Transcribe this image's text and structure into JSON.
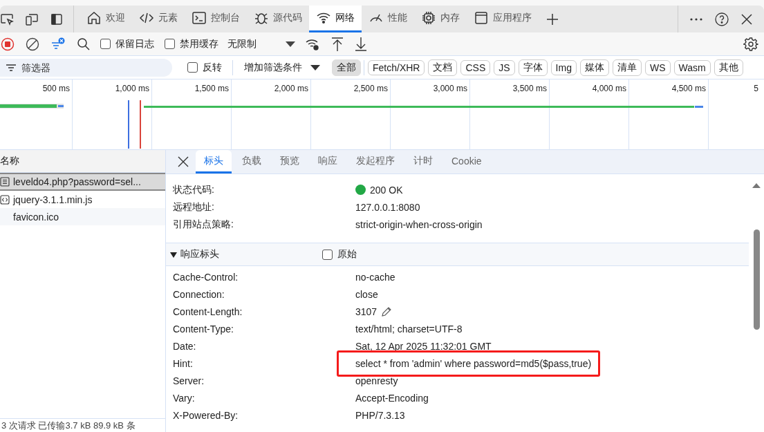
{
  "devtools_tabs": [
    {
      "label": "欢迎",
      "kind": "home",
      "selected": false
    },
    {
      "label": "元素",
      "kind": "code",
      "selected": false
    },
    {
      "label": "控制台",
      "kind": "console",
      "selected": false
    },
    {
      "label": "源代码",
      "kind": "bug",
      "selected": false
    },
    {
      "label": "网络",
      "kind": "wifi",
      "selected": true
    },
    {
      "label": "性能",
      "kind": "gauge",
      "selected": false
    },
    {
      "label": "内存",
      "kind": "chip",
      "selected": false
    },
    {
      "label": "应用程序",
      "kind": "window",
      "selected": false
    }
  ],
  "toolbar": {
    "recording": true,
    "preserve_log": {
      "label": "保留日志",
      "checked": false
    },
    "disable_cache": {
      "label": "禁用缓存",
      "checked": false
    },
    "throttling": "无限制"
  },
  "filter": {
    "placeholder": "筛选器",
    "invert": {
      "label": "反转",
      "checked": false
    },
    "more_filters": "增加筛选条件",
    "types": [
      {
        "label": "全部",
        "selected": true
      },
      {
        "label": "Fetch/XHR",
        "selected": false
      },
      {
        "label": "文档",
        "selected": false
      },
      {
        "label": "CSS",
        "selected": false
      },
      {
        "label": "JS",
        "selected": false
      },
      {
        "label": "字体",
        "selected": false
      },
      {
        "label": "Img",
        "selected": false
      },
      {
        "label": "媒体",
        "selected": false
      },
      {
        "label": "清单",
        "selected": false
      },
      {
        "label": "WS",
        "selected": false
      },
      {
        "label": "Wasm",
        "selected": false
      },
      {
        "label": "其他",
        "selected": false
      }
    ]
  },
  "timeline": {
    "ticks": [
      "500 ms",
      "1,000 ms",
      "1,500 ms",
      "2,000 ms",
      "2,500 ms",
      "3,000 ms",
      "3,500 ms",
      "4,000 ms",
      "4,500 ms",
      "5"
    ]
  },
  "requests": {
    "column": "名称",
    "rows": [
      {
        "name": "leveldo4.php?password=sel...",
        "kind": "document",
        "selected": true
      },
      {
        "name": "jquery-3.1.1.min.js",
        "kind": "script",
        "selected": false
      },
      {
        "name": "favicon.ico",
        "kind": "other",
        "selected": false
      }
    ]
  },
  "detail_tabs": [
    {
      "label": "标头",
      "selected": true
    },
    {
      "label": "负载",
      "selected": false
    },
    {
      "label": "预览",
      "selected": false
    },
    {
      "label": "响应",
      "selected": false
    },
    {
      "label": "发起程序",
      "selected": false
    },
    {
      "label": "计时",
      "selected": false
    },
    {
      "label": "Cookie",
      "selected": false
    }
  ],
  "general": [
    {
      "name": "状态代码:",
      "value": "200 OK",
      "color": "#22a846"
    },
    {
      "name": "远程地址:",
      "value": "127.0.0.1:8080"
    },
    {
      "name": "引用站点策略:",
      "value": "strict-origin-when-cross-origin"
    }
  ],
  "response_headers": {
    "title": "响应标头",
    "expanded": true,
    "raw": {
      "label": "原始",
      "checked": false
    },
    "rows": [
      {
        "name": "Cache-Control:",
        "value": "no-cache",
        "kind": "plain"
      },
      {
        "name": "Connection:",
        "value": "close",
        "kind": "plain"
      },
      {
        "name": "Content-Length:",
        "value": "3107",
        "kind": "editable"
      },
      {
        "name": "Content-Type:",
        "value": "text/html; charset=UTF-8",
        "kind": "plain"
      },
      {
        "name": "Date:",
        "value": "Sat, 12 Apr 2025 11:32:01 GMT",
        "kind": "plain"
      },
      {
        "name": "Hint:",
        "value": "select * from 'admin' where password=md5($pass,true)",
        "kind": "highlighted"
      },
      {
        "name": "Server:",
        "value": "openresty",
        "kind": "plain"
      },
      {
        "name": "Vary:",
        "value": "Accept-Encoding",
        "kind": "plain"
      },
      {
        "name": "X-Powered-By:",
        "value": "PHP/7.3.13",
        "kind": "plain"
      }
    ]
  },
  "status_bar": "3 次请求  已传输3.7 kB  89.9 kB 条"
}
